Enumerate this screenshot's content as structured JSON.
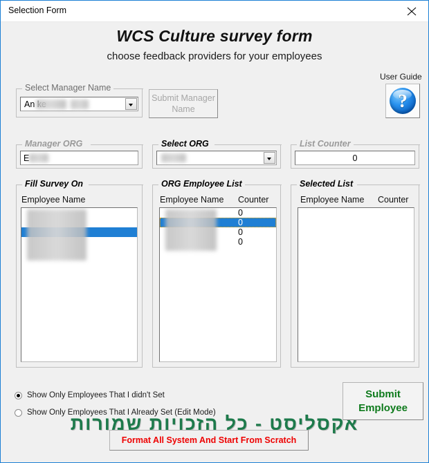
{
  "window": {
    "title": "Selection Form",
    "close_icon": "close-icon",
    "border_color": "#1b7fd4"
  },
  "header": {
    "title": "WCS Culture survey form",
    "subtitle": "choose feedback providers for your employees"
  },
  "user_guide": {
    "label": "User Guide",
    "icon": "question-mark-icon",
    "glyph": "?"
  },
  "manager": {
    "group_label": "Select Manager Name",
    "combo_value": "An        ke",
    "combo_value_redacted": true,
    "submit_button": "Submit Manager Name",
    "submit_disabled": true
  },
  "manager_org": {
    "group_label": "Manager ORG",
    "value": "E",
    "value_redacted": true
  },
  "select_org": {
    "group_label": "Select ORG",
    "value": "",
    "value_redacted": true
  },
  "list_counter": {
    "group_label": "List Counter",
    "value": "0"
  },
  "fill_survey": {
    "group_label": "Fill Survey On",
    "column_headers": [
      "Employee Name"
    ],
    "rows": [
      {
        "name": "",
        "redacted": true,
        "selected": false
      },
      {
        "name": "",
        "redacted": true,
        "selected": false
      },
      {
        "name": "",
        "redacted": true,
        "selected": true
      },
      {
        "name": "",
        "redacted": true,
        "selected": false
      },
      {
        "name": "",
        "redacted": true,
        "selected": false
      }
    ]
  },
  "org_employee_list": {
    "group_label": "ORG Employee List",
    "column_headers": [
      "Employee Name",
      "Counter"
    ],
    "rows": [
      {
        "name": "",
        "counter": "0",
        "redacted": true,
        "selected": false
      },
      {
        "name": "",
        "counter": "0",
        "redacted": true,
        "selected": true
      },
      {
        "name": "",
        "counter": "0",
        "redacted": true,
        "selected": false
      },
      {
        "name": "",
        "counter": "0",
        "redacted": true,
        "selected": false
      }
    ]
  },
  "selected_list": {
    "group_label": "Selected List",
    "column_headers": [
      "Employee Name",
      "Counter"
    ],
    "rows": []
  },
  "options": {
    "radio_not_set": "Show Only Employees That I didn't Set",
    "radio_already_set": "Show Only Employees That I Already Set (Edit Mode)",
    "selected_index": 0
  },
  "actions": {
    "submit_employee_line1": "Submit",
    "submit_employee_line2": "Employee",
    "submit_employee_color": "#0e7a1c",
    "format_system": "Format All System And Start From Scratch",
    "format_system_color": "#ee0000"
  },
  "watermark": {
    "text": "אקסליסט  -  כל הזכויות שמורות",
    "color": "#1d7a4b"
  }
}
